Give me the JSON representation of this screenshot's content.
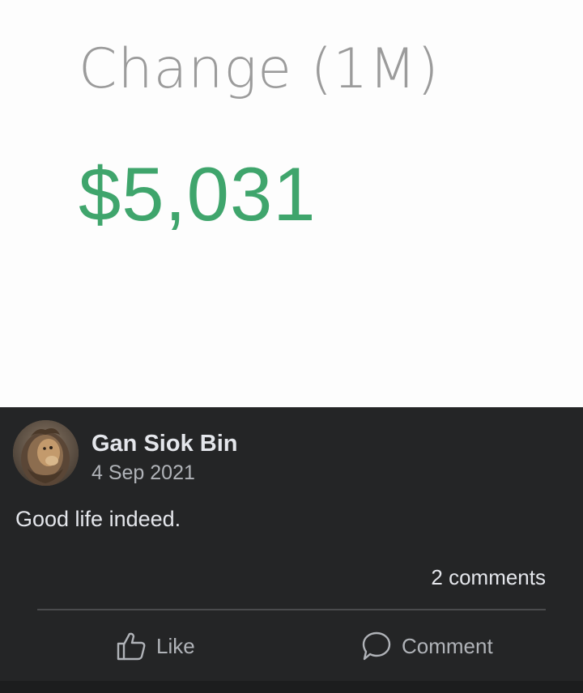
{
  "media": {
    "change_label": "Change (1M)",
    "change_value": "$5,031",
    "value_color": "#3fa56c"
  },
  "post": {
    "author": "Gan Siok Bin",
    "date": "4 Sep 2021",
    "text": "Good life indeed.",
    "comments_count": "2 comments",
    "avatar_icon": "lion-avatar"
  },
  "actions": {
    "like_label": "Like",
    "like_icon": "thumbs-up-icon",
    "comment_label": "Comment",
    "comment_icon": "speech-bubble-icon"
  },
  "colors": {
    "post_background": "#242526",
    "primary_text": "#e4e6eb",
    "secondary_text": "#b0b3b8"
  }
}
